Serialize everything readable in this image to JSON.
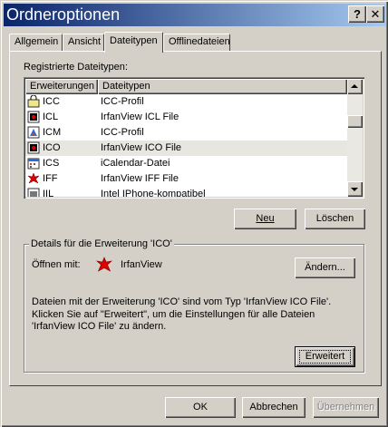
{
  "window": {
    "title": "Ordneroptionen",
    "help_icon": "?",
    "close_icon": "✕"
  },
  "tabs": [
    {
      "label": "Allgemein"
    },
    {
      "label": "Ansicht"
    },
    {
      "label": "Dateitypen"
    },
    {
      "label": "Offlinedateien"
    }
  ],
  "active_tab": "Dateitypen",
  "registered": {
    "label": "Registrierte Dateitypen:",
    "columns": [
      "Erweiterungen",
      "Dateitypen"
    ],
    "rows": [
      {
        "ext": "ICC",
        "type": "ICC-Profil",
        "icon": "icc-profile-icon"
      },
      {
        "ext": "ICL",
        "type": "IrfanView ICL File",
        "icon": "irfanview-icl-icon"
      },
      {
        "ext": "ICM",
        "type": "ICC-Profil",
        "icon": "icm-profile-icon"
      },
      {
        "ext": "ICO",
        "type": "IrfanView ICO File",
        "icon": "irfanview-ico-icon",
        "selected": true
      },
      {
        "ext": "ICS",
        "type": "iCalendar-Datei",
        "icon": "icalendar-icon"
      },
      {
        "ext": "IFF",
        "type": "IrfanView IFF File",
        "icon": "irfanview-iff-icon"
      },
      {
        "ext": "IIL",
        "type": "Intel IPhone-kompatibel",
        "icon": "intel-iphone-icon"
      }
    ]
  },
  "buttons": {
    "new": "Neu",
    "delete": "Löschen",
    "change": "Ändern...",
    "advanced": "Erweitert"
  },
  "details": {
    "legend": "Details für die Erweiterung 'ICO'",
    "opens_with_label": "Öffnen mit:",
    "opens_with_app": "IrfanView",
    "description": "Dateien mit der Erweiterung 'ICO' sind vom Typ 'IrfanView ICO File'. Klicken Sie auf \"Erweitert\", um die Einstellungen für alle Dateien 'IrfanView ICO File' zu ändern."
  },
  "footer": {
    "ok": "OK",
    "cancel": "Abbrechen",
    "apply": "Übernehmen"
  }
}
